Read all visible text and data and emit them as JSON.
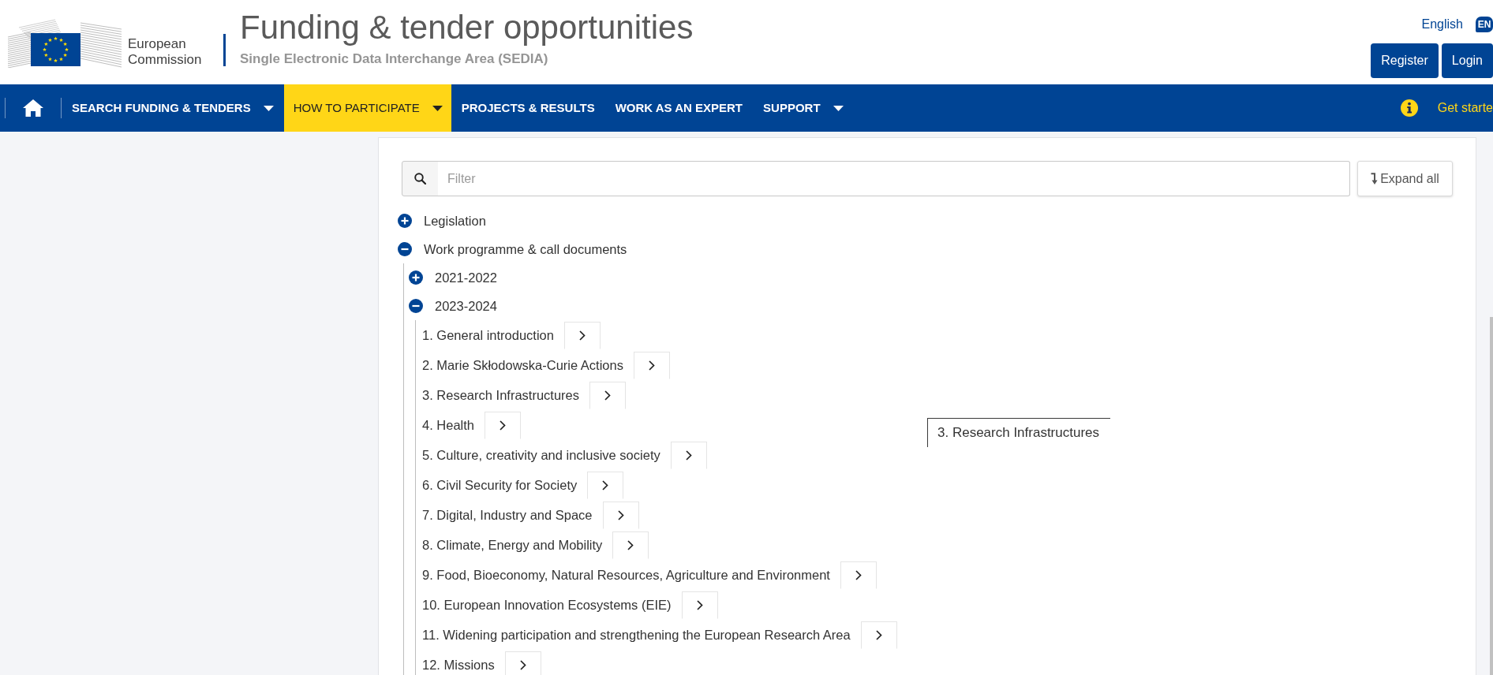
{
  "header": {
    "organization": "European Commission",
    "title": "Funding & tender opportunities",
    "subtitle": "Single Electronic Data Interchange Area (SEDIA)",
    "language": "English",
    "language_code": "EN",
    "buttons": [
      "Register",
      "Login"
    ]
  },
  "nav": {
    "items": [
      {
        "label": "SEARCH FUNDING & TENDERS",
        "dropdown": true,
        "selected": false
      },
      {
        "label": "HOW TO PARTICIPATE",
        "dropdown": true,
        "selected": true
      },
      {
        "label": "PROJECTS & RESULTS",
        "dropdown": false,
        "selected": false
      },
      {
        "label": "WORK AS AN EXPERT",
        "dropdown": false,
        "selected": false
      },
      {
        "label": "SUPPORT",
        "dropdown": true,
        "selected": false
      }
    ],
    "help_link": "Get starte"
  },
  "filter": {
    "placeholder": "Filter"
  },
  "expand_button": "Expand all",
  "tree": [
    {
      "label": "Legislation",
      "expanded": false
    },
    {
      "label": "Work programme & call documents",
      "expanded": true,
      "children": [
        {
          "label": "2021-2022",
          "expanded": false
        },
        {
          "label": "2023-2024",
          "expanded": true,
          "children": [
            {
              "label": "1. General introduction"
            },
            {
              "label": "2. Marie Skłodowska-Curie Actions"
            },
            {
              "label": "3. Research Infrastructures"
            },
            {
              "label": "4. Health"
            },
            {
              "label": "5. Culture, creativity and inclusive society"
            },
            {
              "label": "6. Civil Security for Society"
            },
            {
              "label": "7. Digital, Industry and Space"
            },
            {
              "label": "8. Climate, Energy and Mobility"
            },
            {
              "label": "9. Food, Bioeconomy, Natural Resources, Agriculture and Environment"
            },
            {
              "label": "10. European Innovation Ecosystems (EIE)"
            },
            {
              "label": "11. Widening participation and strengthening the European Research Area"
            },
            {
              "label": "12. Missions"
            }
          ]
        }
      ]
    }
  ],
  "tooltip": "3. Research Infrastructures"
}
